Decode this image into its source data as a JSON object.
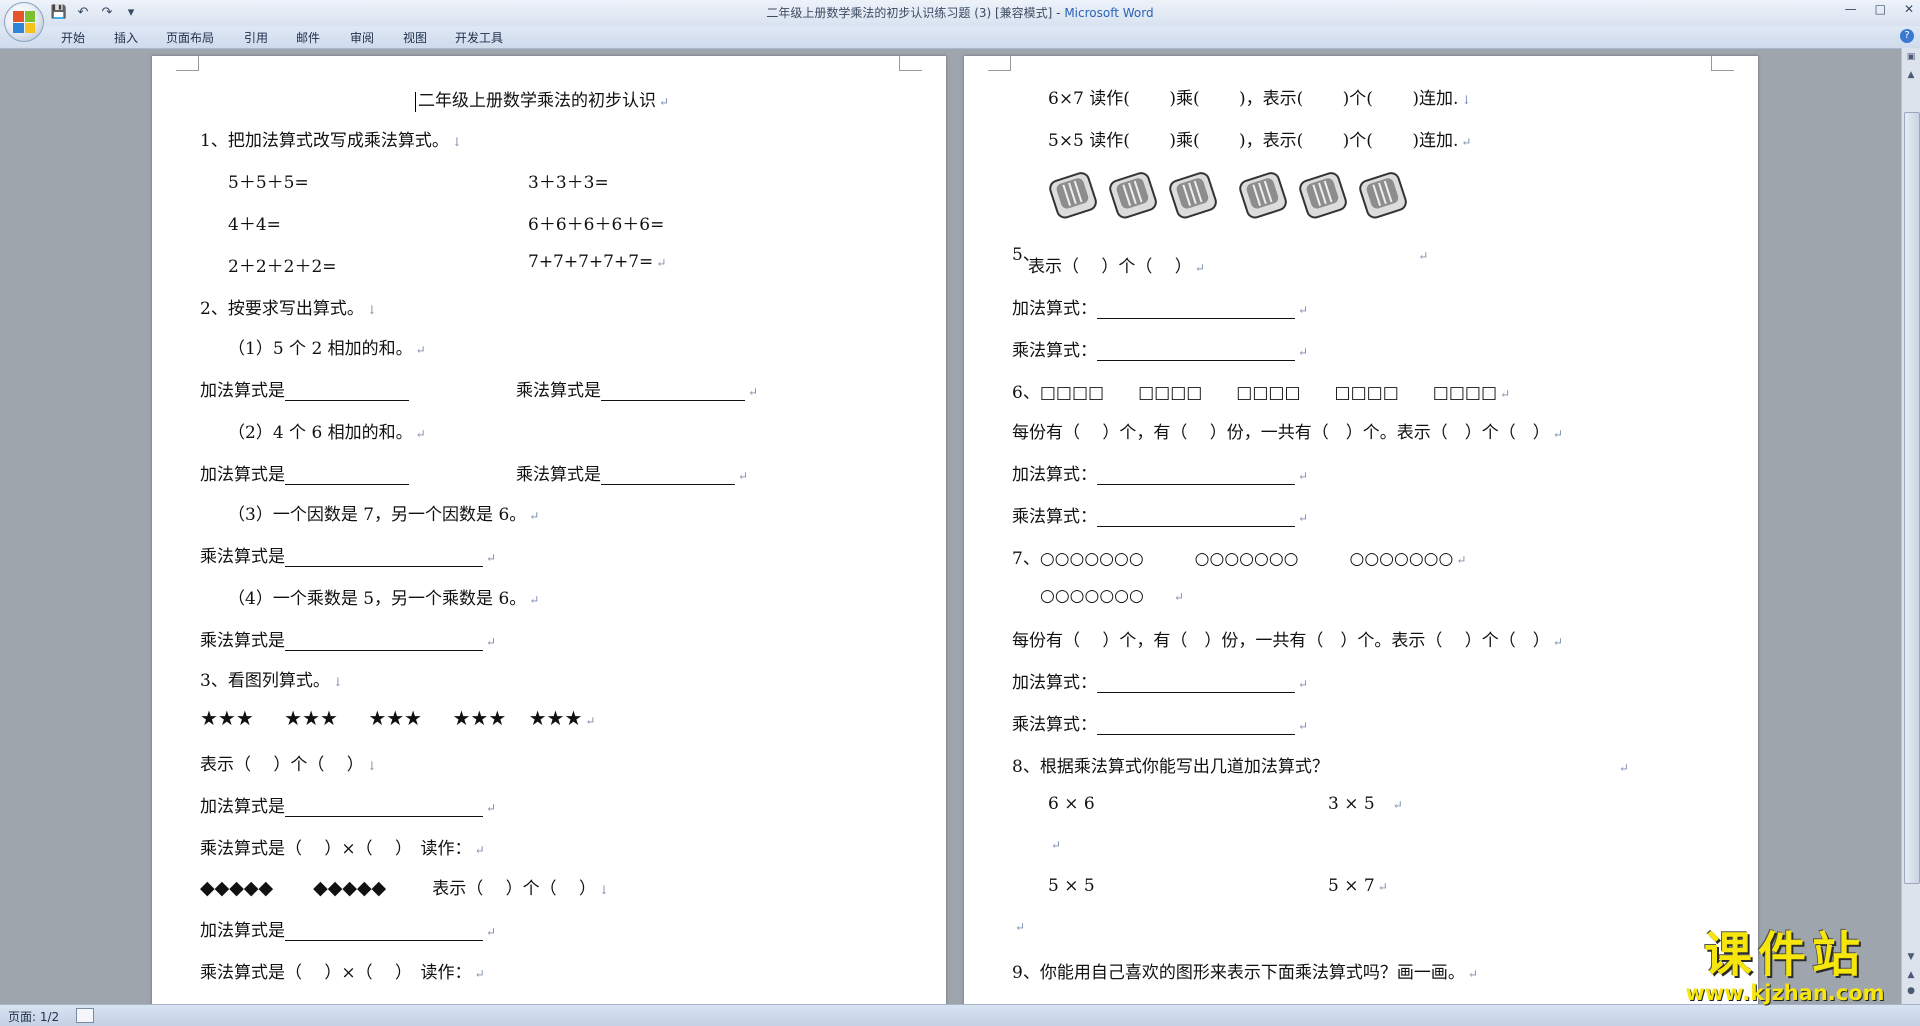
{
  "window": {
    "title": "二年级上册数学乘法的初步认识练习题 (3) [兼容模式] - ",
    "app_name": "Microsoft Word",
    "minimize": "—",
    "maximize": "□",
    "close": "✕"
  },
  "qat": {
    "save": "💾",
    "undo": "↶",
    "redo": "↷",
    "more": "▾"
  },
  "ribbon": {
    "tabs": [
      "开始",
      "插入",
      "页面布局",
      "引用",
      "邮件",
      "审阅",
      "视图",
      "开发工具"
    ],
    "help": "?"
  },
  "page1": {
    "title": "二年级上册数学乘法的初步认识",
    "q1": "1、把加法算式改写成乘法算式。",
    "q1_items": [
      "5＋5＋5=",
      "3＋3＋3=",
      "4＋4=",
      "6＋6＋6＋6＋6=",
      "2＋2＋2＋2=",
      "7+7+7+7+7="
    ],
    "q2": "2、按要求写出算式。",
    "q2_1": "（1）5 个 2 相加的和。",
    "add_is": "加法算式是",
    "mul_is": "乘法算式是",
    "q2_2": "（2）4 个 6 相加的和。",
    "q2_3": "（3）一个因数是 7，另一个因数是 6。",
    "q2_4": "（4）一个乘数是 5，另一个乘数是 6。",
    "q3": "3、看图列算式。",
    "stars": "★★★",
    "biaoshi": "表示（　 ）个（　 ）",
    "mul_read": "乘法算式是（　 ）×（　 ）　读作：",
    "diamonds": "◆◆◆◆◆",
    "biaoshi2": "表示（　 ）个（　 ）"
  },
  "page2": {
    "l1": "6×7 读作(　　 )乘(　　 )，表示(　　 )个(　　 )连加.",
    "l2": "5×5 读作(　　 )乘(　　 )，表示(　　 )个(　　 )连加.",
    "q5": "5、",
    "q5_biaoshi": "表示（　 ）个（　 ）",
    "add_colon": "加法算式：",
    "mul_colon": "乘法算式：",
    "q6": "6、□□□□　　□□□□　　□□□□　　□□□□　　□□□□",
    "each": "每份有（　 ）个，有（　 ）份，一共有（　）个。表示（　）个（　）",
    "q7": "7、○○○○○○○　　　○○○○○○○　　　○○○○○○○",
    "q7b": "○○○○○○○",
    "each7": "每份有（　 ）个，有（　）份，一共有（　）个。表示（　 ）个（　）",
    "q8": "8、根据乘法算式你能写出几道加法算式？",
    "q8_items": [
      "6 × 6",
      "3 × 5",
      "5 × 5",
      "5 × 7"
    ],
    "q9": "9、你能用自己喜欢的图形来表示下面乘法算式吗？画一画。"
  },
  "status": {
    "page": "页面: 1/2"
  },
  "watermark": {
    "top": "课件站",
    "bottom": "www.kjzhan.com"
  },
  "colors": {
    "accent": "#2b62b8",
    "watermark": "#f6e60c"
  }
}
